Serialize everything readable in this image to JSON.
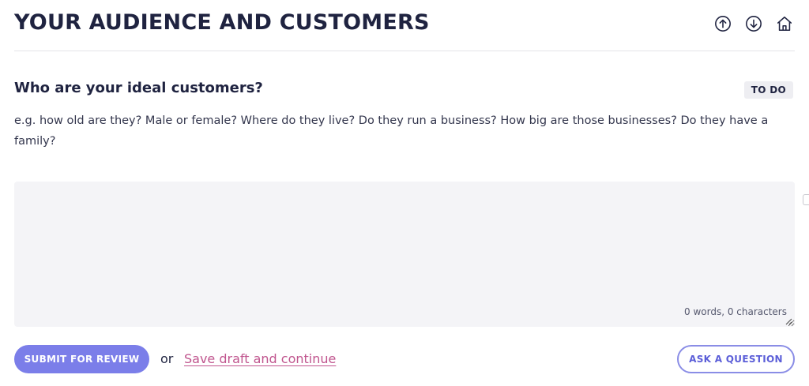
{
  "section": {
    "title": "YOUR AUDIENCE AND CUSTOMERS"
  },
  "nav": {
    "icons": [
      "arrow-up-circle-icon",
      "arrow-down-circle-icon",
      "home-icon"
    ],
    "icon_color": "#1f2340"
  },
  "question": {
    "title": "Who are your ideal customers?",
    "status": "TO DO",
    "hint": "e.g. how old are they? Male or female? Where do they live? Do they run a business? How big are those businesses? Do they have a family?"
  },
  "answer": {
    "value": "",
    "counter": "0 words, 0 characters"
  },
  "actions": {
    "submit_label": "SUBMIT FOR REVIEW",
    "or_text": "or",
    "draft_link": "Save draft and continue",
    "ask_label": "ASK A QUESTION"
  },
  "colors": {
    "primary": "#7b7ee9",
    "link": "#c0558e",
    "text": "#1f2340",
    "field_bg": "#f4f4f7"
  }
}
